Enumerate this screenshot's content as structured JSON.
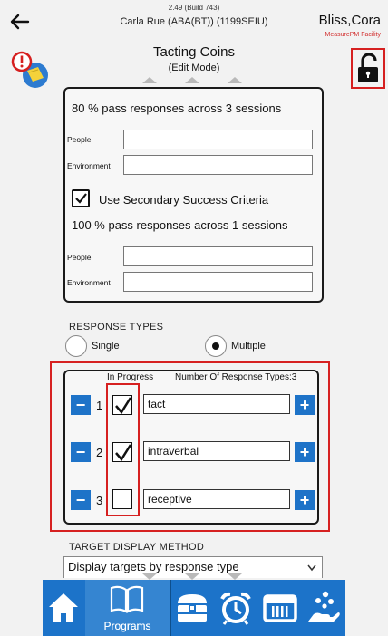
{
  "header": {
    "build": "2.49 (Build 743)",
    "client": "Carla Rue (ABA(BT)) (1199SEIU)",
    "user": "Bliss,Cora",
    "facility": "MeasurePM Facility"
  },
  "page": {
    "title": "Tacting Coins",
    "mode": "(Edit Mode)"
  },
  "criteria": {
    "primary": "80 % pass responses across 3 sessions",
    "people_label": "People",
    "environment_label": "Environment",
    "secondary_label": "Use Secondary Success Criteria",
    "secondary_checked": true,
    "secondary": "100 % pass responses across 1 sessions",
    "people_value": "",
    "environment_value": ""
  },
  "response_types": {
    "heading": "RESPONSE TYPES",
    "single": "Single",
    "multiple": "Multiple",
    "selected": "Multiple",
    "in_progress_label": "In Progress",
    "count_label": "Number Of Response Types:3",
    "rows": [
      {
        "index": "1",
        "value": "tact",
        "checked": true
      },
      {
        "index": "2",
        "value": "intraverbal",
        "checked": true
      },
      {
        "index": "3",
        "value": "receptive",
        "checked": false
      }
    ]
  },
  "target_display": {
    "heading": "TARGET DISPLAY METHOD",
    "value": "Display targets by response type"
  },
  "nav": {
    "items": [
      {
        "icon": "home-icon",
        "label": ""
      },
      {
        "icon": "book-icon",
        "label": "Programs"
      },
      {
        "icon": "treasure-chest-icon",
        "label": ""
      },
      {
        "icon": "alarm-clock-icon",
        "label": ""
      },
      {
        "icon": "calendar-icon",
        "label": ""
      },
      {
        "icon": "hand-stars-icon",
        "label": ""
      }
    ],
    "selected": "Programs"
  },
  "colors": {
    "accent": "#1c73c9",
    "highlight": "#d62020"
  }
}
